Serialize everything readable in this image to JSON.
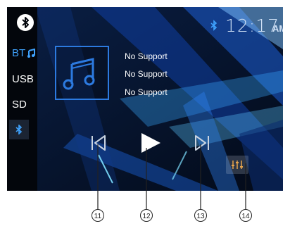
{
  "clock": {
    "time": "12:17",
    "ampm": "AM"
  },
  "sidebar": {
    "items": [
      {
        "label": "BT",
        "icon": "music-note-icon"
      },
      {
        "label": "USB"
      },
      {
        "label": "SD"
      },
      {
        "icon": "bluetooth-icon"
      }
    ],
    "top_icon": "bluetooth-icon"
  },
  "track": {
    "title": "No Support",
    "artist": "No Support",
    "album": "No Support"
  },
  "controls": {
    "prev_icon": "previous-track-icon",
    "play_icon": "play-icon",
    "next_icon": "next-track-icon",
    "eq_icon": "equalizer-icon"
  },
  "callouts": [
    "11",
    "12",
    "13",
    "14"
  ],
  "colors": {
    "accent": "#3fa3ff",
    "background": "#061226"
  }
}
